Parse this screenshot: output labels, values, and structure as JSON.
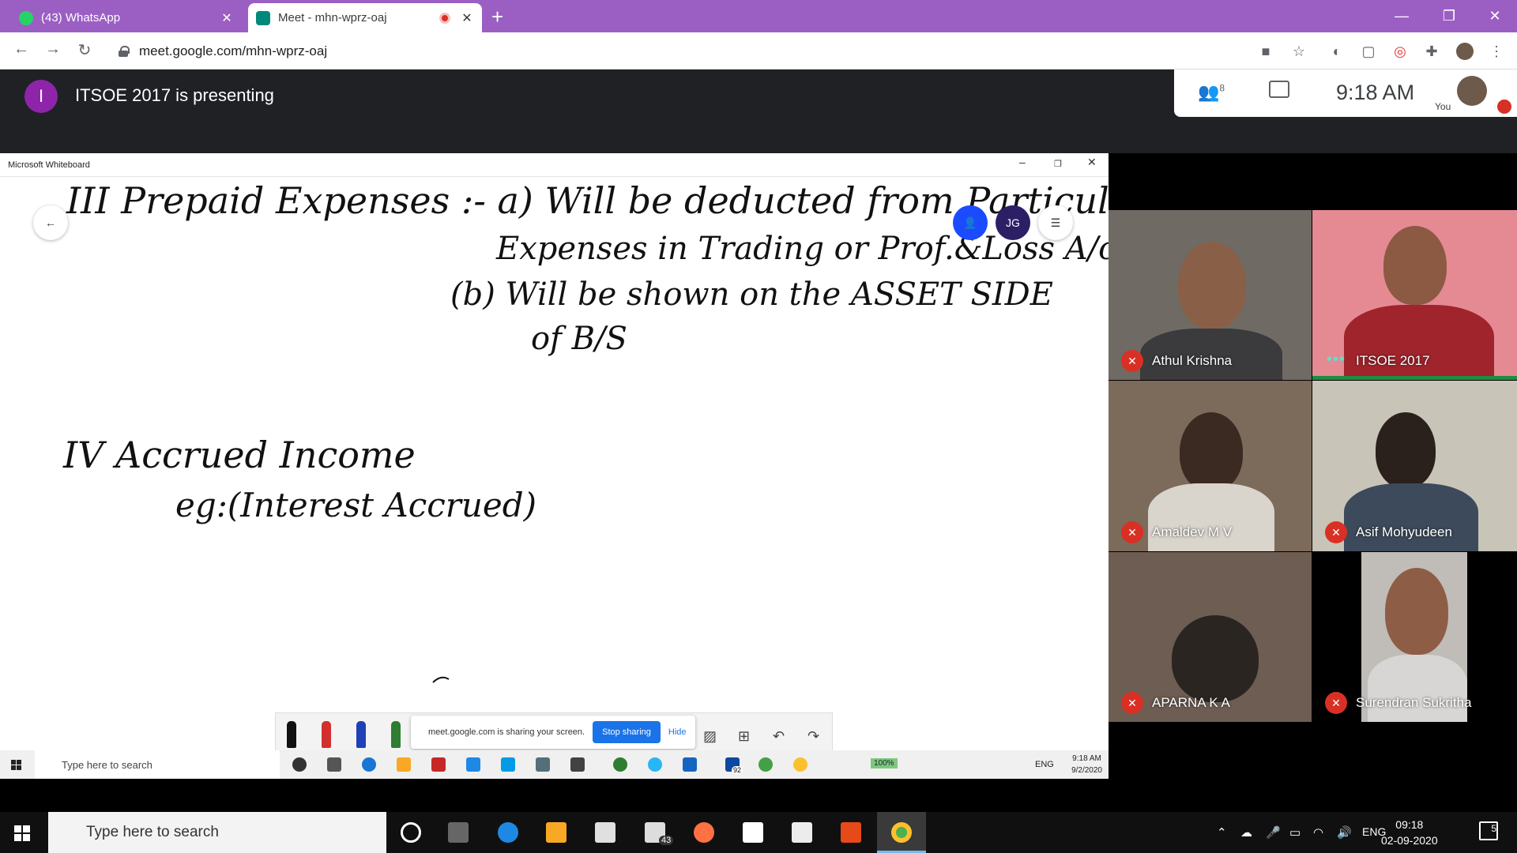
{
  "browser": {
    "tabs": [
      {
        "label": "(43) WhatsApp",
        "icon": "whatsapp-icon",
        "active": false
      },
      {
        "label": "Meet - mhn-wprz-oaj",
        "icon": "google-meet-icon",
        "active": true
      }
    ],
    "url": "meet.google.com/mhn-wprz-oaj",
    "accent": "#9b5fc4"
  },
  "meet": {
    "presenter_initial": "I",
    "presenting_text": "ITSOE 2017 is presenting",
    "people_count": "8",
    "time": "9:18 AM",
    "you_label": "You"
  },
  "whiteboard": {
    "title": "Microsoft Whiteboard",
    "user_initials": "JG",
    "share_message": "meet.google.com is sharing your screen.",
    "stop_sharing": "Stop sharing",
    "hide": "Hide",
    "handwriting": [
      "III Prepaid Expenses :- a) Will be deducted from Particular",
      "Expenses in Trading or Prof.&Loss A/c",
      "(b) Will be shown on the ASSET SIDE",
      "of B/S",
      "IV Accrued Income",
      "eg:(Interest Accrued)"
    ]
  },
  "inner_taskbar": {
    "search_placeholder": "Type here to search",
    "badge": "92",
    "battery": "100%",
    "lang": "ENG",
    "time": "9:18 AM",
    "date": "9/2/2020"
  },
  "participants": [
    {
      "name": "Athul Krishna",
      "muted": true
    },
    {
      "name": "ITSOE 2017",
      "muted": false
    },
    {
      "name": "Amaldev M V",
      "muted": true
    },
    {
      "name": "Asif Mohyudeen",
      "muted": true
    },
    {
      "name": "APARNA K A",
      "muted": true
    },
    {
      "name": "Surendran Sukritha",
      "muted": true
    }
  ],
  "taskbar": {
    "search_placeholder": "Type here to search",
    "mail_badge": "43",
    "lang": "ENG",
    "time": "09:18",
    "date": "02-09-2020",
    "notifications": "5"
  }
}
